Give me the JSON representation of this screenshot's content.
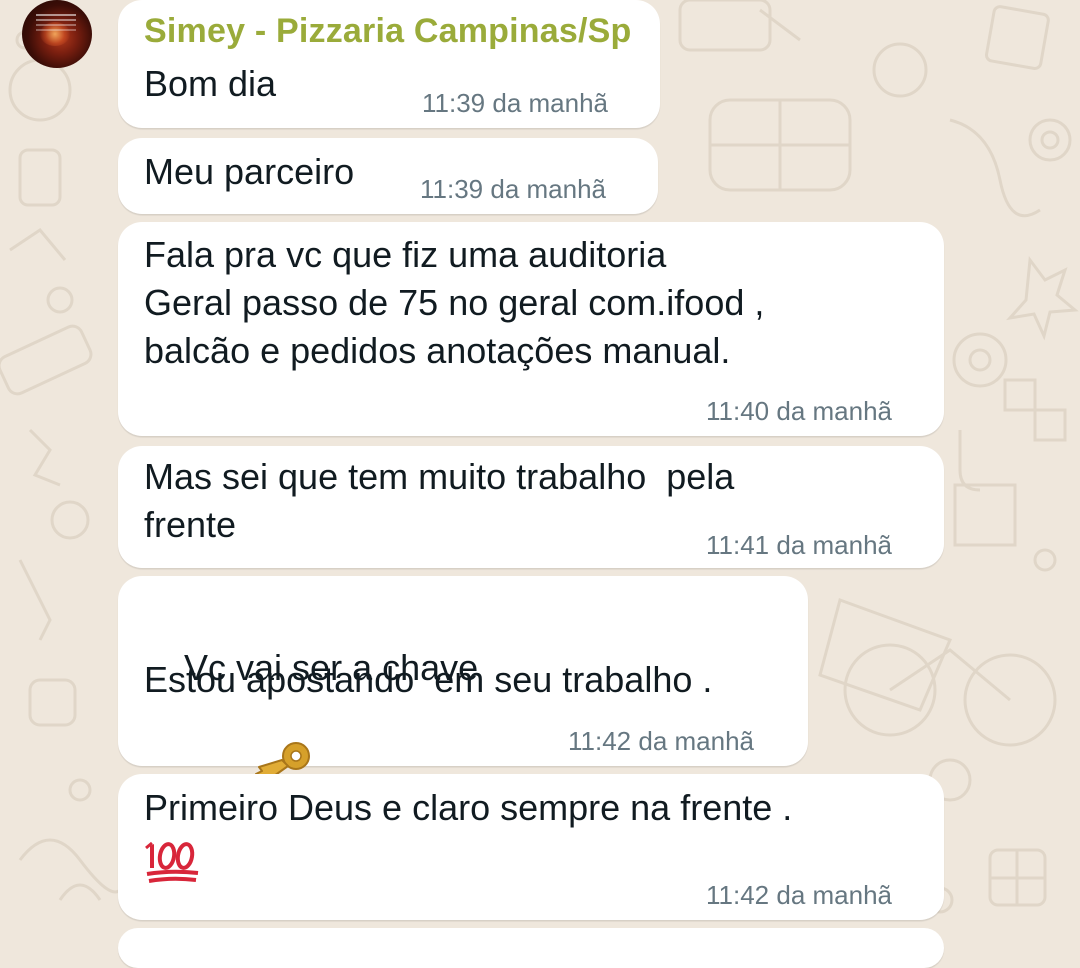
{
  "chat": {
    "sender_name": "Simey - Pizzaria Campinas/Sp",
    "messages": [
      {
        "text": "Bom dia",
        "time": "11:39 da manhã"
      },
      {
        "text": "Meu parceiro",
        "time": "11:39 da manhã"
      },
      {
        "lines": [
          "Fala pra vc que fiz uma auditoria",
          "Geral passo de 75 no geral com.ifood ,",
          "balcão e pedidos anotações manual."
        ],
        "time": "11:40 da manhã"
      },
      {
        "lines": [
          "Mas sei que tem muito trabalho  pela",
          "frente"
        ],
        "time": "11:41 da manhã"
      },
      {
        "lines": [
          "Vc vai ser a chave",
          "Estou apostando  em seu trabalho ."
        ],
        "emoji": "key-emoji",
        "time": "11:42 da manhã"
      },
      {
        "lines": [
          "Primeiro Deus e claro sempre na frente ."
        ],
        "emoji": "hundred-points-emoji",
        "time": "11:42 da manhã"
      }
    ]
  },
  "colors": {
    "wallpaper": "#efe7dc",
    "bubble": "#ffffff",
    "sender_name": "#9aab3a",
    "text": "#111b21",
    "timestamp": "#667781"
  }
}
